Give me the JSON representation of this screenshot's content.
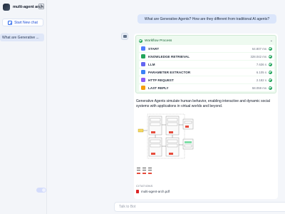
{
  "app": {
    "name": "multi-agent arch"
  },
  "sidebar": {
    "new_chat_label": "Start New chat",
    "conversations": [
      {
        "label": "What are Generative ..."
      }
    ]
  },
  "chat": {
    "user_message": "What are Generative Agents? How are they different from traditional AI agents?",
    "workflow": {
      "title": "Workflow Process",
      "nodes": [
        {
          "name": "START",
          "time": "64.807 ms",
          "color": "#4f7cff",
          "icon": "home-icon"
        },
        {
          "name": "KNOWLEDGE RETRIEVAL",
          "time": "328.042 ms",
          "color": "#22a55b",
          "icon": "database-icon"
        },
        {
          "name": "LLM",
          "time": "7.636 s",
          "color": "#6366f1",
          "icon": "brain-icon"
        },
        {
          "name": "PARAMETER EXTRACTOR",
          "time": "6.105 s",
          "color": "#3b82f6",
          "icon": "extract-icon"
        },
        {
          "name": "HTTP REQUEST",
          "time": "2.182 s",
          "color": "#8b5cf6",
          "icon": "globe-icon"
        },
        {
          "name": "LAST REPLY",
          "time": "58.059 ms",
          "color": "#f59e0b",
          "icon": "reply-icon"
        }
      ]
    },
    "answer_text": "Generative Agents simulate human behavior, enabling interactive and dynamic social systems with applications in virtual worlds and beyond.",
    "citations_label": "CITATIONS",
    "citations": [
      {
        "file": "multi-agent-arch.pdf"
      }
    ]
  },
  "input": {
    "placeholder": "Talk to Bot"
  }
}
